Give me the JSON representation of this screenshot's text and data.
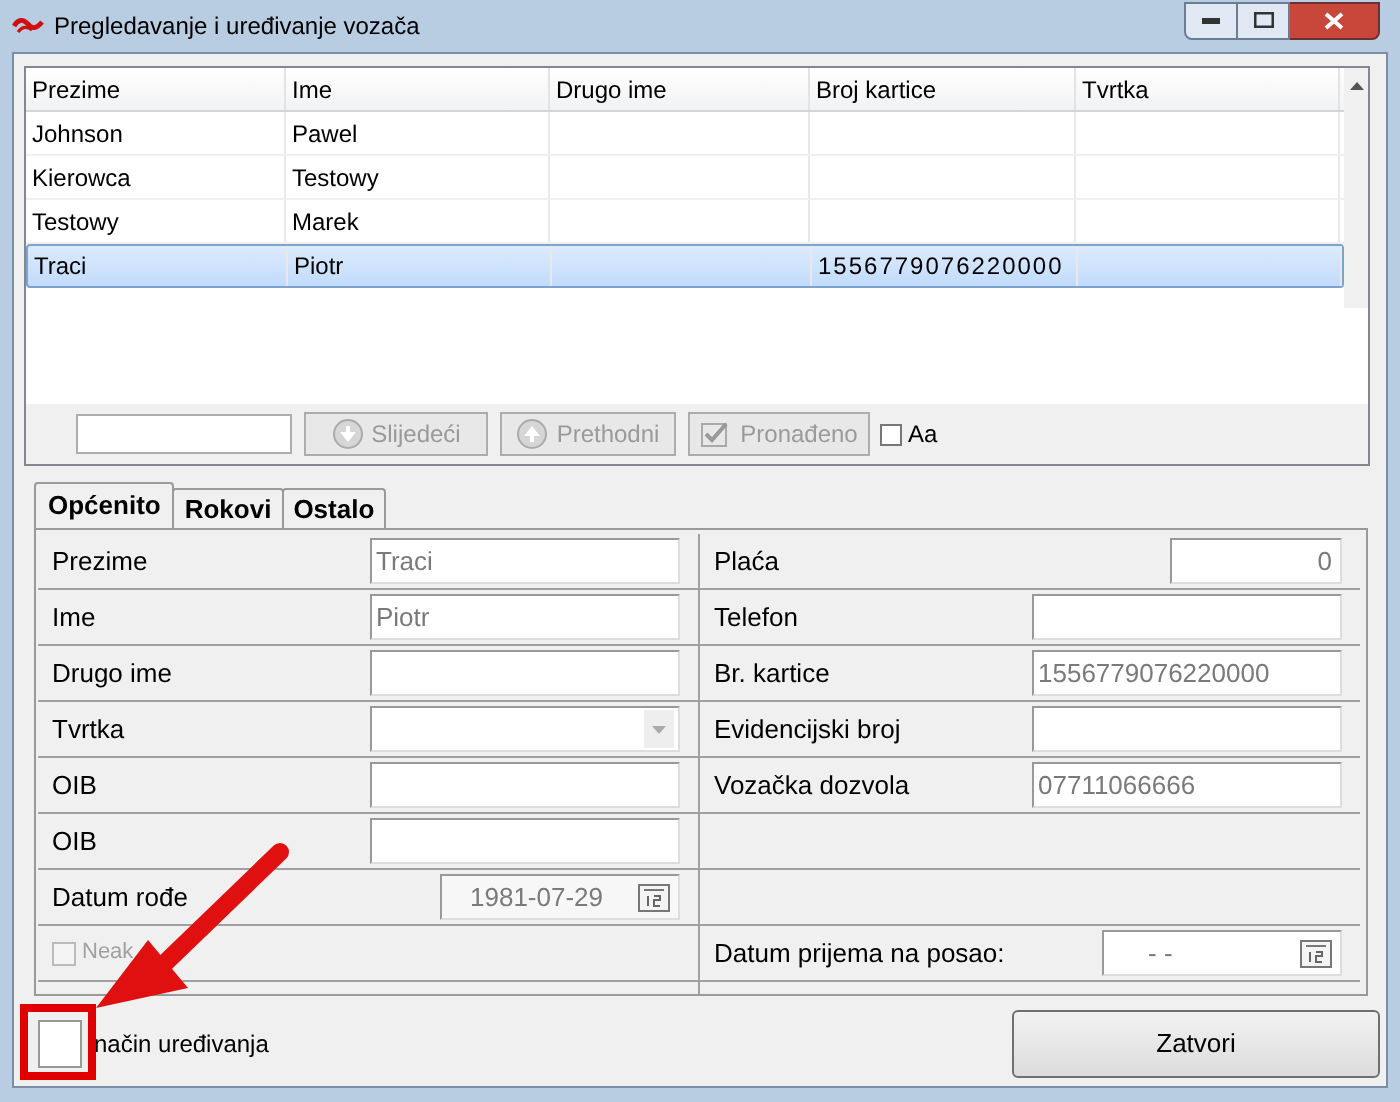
{
  "window": {
    "title": "Pregledavanje i uređivanje vozača"
  },
  "table": {
    "columns": [
      "Prezime",
      "Ime",
      "Drugo ime",
      "Broj kartice",
      "Tvrtka"
    ],
    "rows": [
      {
        "cells": [
          "Johnson",
          "Pawel",
          "",
          "",
          ""
        ],
        "selected": false
      },
      {
        "cells": [
          "Kierowca",
          "Testowy",
          "",
          "",
          ""
        ],
        "selected": false
      },
      {
        "cells": [
          "Testowy",
          "Marek",
          "",
          "",
          ""
        ],
        "selected": false
      },
      {
        "cells": [
          "Traci",
          "Piotr",
          "",
          "1556779076220000",
          ""
        ],
        "selected": true
      }
    ]
  },
  "search": {
    "buttons": [
      {
        "label": "Slijedeći",
        "kind": "down"
      },
      {
        "label": "Prethodni",
        "kind": "up"
      },
      {
        "label": "Pronađeno",
        "kind": "found"
      }
    ],
    "match_case": {
      "label": "Aa",
      "checked": false
    }
  },
  "tabs": [
    {
      "label": "Općenito",
      "selected": true
    },
    {
      "label": "Rokovi",
      "selected": false
    },
    {
      "label": "Ostalo",
      "selected": false
    }
  ],
  "left_fields": [
    {
      "kind": "text",
      "label": "Prezime",
      "value": "Traci"
    },
    {
      "kind": "text",
      "label": "Ime",
      "value": "Piotr"
    },
    {
      "kind": "text",
      "label": "Drugo ime"
    },
    {
      "kind": "combo",
      "label": "Tvrtka"
    },
    {
      "kind": "text",
      "label": "OIB"
    },
    {
      "kind": "text",
      "label": "OIB"
    },
    {
      "kind": "date",
      "label": "Datum rođe",
      "value": "1981-07-29"
    },
    {
      "kind": "checkbox",
      "label": "Neak",
      "checked": false,
      "disabled": true
    }
  ],
  "right_fields": [
    {
      "kind": "number",
      "label": "Plaća",
      "value": "0"
    },
    {
      "kind": "text",
      "label": "Telefon"
    },
    {
      "kind": "text",
      "label": "Br. kartice",
      "value": "1556779076220000"
    },
    {
      "kind": "text",
      "label": "Evidencijski broj"
    },
    {
      "kind": "text",
      "label": "Vozačka dozvola",
      "value": "07711066666"
    },
    {
      "kind": "empty"
    },
    {
      "kind": "empty"
    },
    {
      "kind": "date",
      "label": "Datum prijema na posao:",
      "value": "-  -"
    }
  ],
  "edit_mode": {
    "label": "način uređivanja",
    "checked": false
  },
  "close_button": {
    "label": "Zatvori"
  }
}
